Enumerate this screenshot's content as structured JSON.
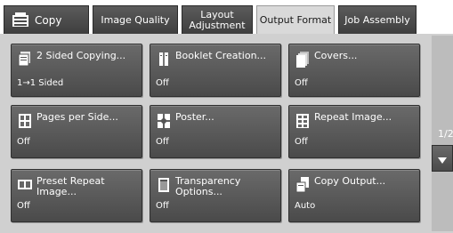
{
  "tabs": [
    {
      "label": "Copy",
      "icon": "copy-machine-icon"
    },
    {
      "label": "Image Quality"
    },
    {
      "label": "Layout\nAdjustment"
    },
    {
      "label": "Output Format",
      "active": true
    },
    {
      "label": "Job Assembly"
    }
  ],
  "buttons": [
    {
      "label": "2 Sided Copying...",
      "value": "1→1 Sided",
      "icon": "two-sided-copy-icon"
    },
    {
      "label": "Booklet Creation...",
      "value": "Off",
      "icon": "booklet-icon"
    },
    {
      "label": "Covers...",
      "value": "Off",
      "icon": "covers-icon"
    },
    {
      "label": "Pages per Side...",
      "value": "Off",
      "icon": "pages-per-side-icon"
    },
    {
      "label": "Poster...",
      "value": "Off",
      "icon": "poster-icon"
    },
    {
      "label": "Repeat Image...",
      "value": "Off",
      "icon": "repeat-image-icon"
    },
    {
      "label": "Preset Repeat Image...",
      "value": "Off",
      "icon": "preset-repeat-image-icon"
    },
    {
      "label": "Transparency\nOptions...",
      "value": "Off",
      "icon": "transparency-icon"
    },
    {
      "label": "Copy Output...",
      "value": "Auto",
      "icon": "copy-output-icon"
    }
  ],
  "pager": {
    "indicator": "1/2",
    "down_icon": "triangle-down-icon"
  },
  "colors": {
    "tab_dark": "#4a4a4a",
    "tab_active": "#d9d9d9",
    "button_dark": "#555555",
    "panel": "#d0d0d0"
  }
}
